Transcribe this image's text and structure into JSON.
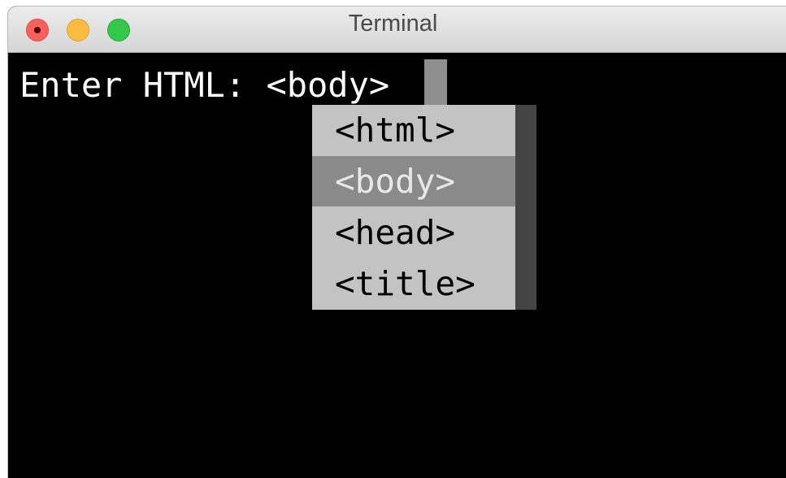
{
  "window": {
    "title": "Terminal"
  },
  "terminal": {
    "prompt": "Enter HTML: ",
    "input_value": "<body>"
  },
  "autocomplete": {
    "items": [
      {
        "label": "<html>",
        "selected": false
      },
      {
        "label": "<body>",
        "selected": true
      },
      {
        "label": "<head>",
        "selected": false
      },
      {
        "label": "<title>",
        "selected": false
      }
    ],
    "selected_index": 1
  },
  "colors": {
    "close": "#fc605c",
    "minimize": "#fdbc40",
    "maximize": "#34c84a",
    "terminal_bg": "#000000",
    "popup_bg": "#c3c3c3",
    "popup_selected_bg": "#8a8a8a",
    "scrollbar": "#444444"
  }
}
